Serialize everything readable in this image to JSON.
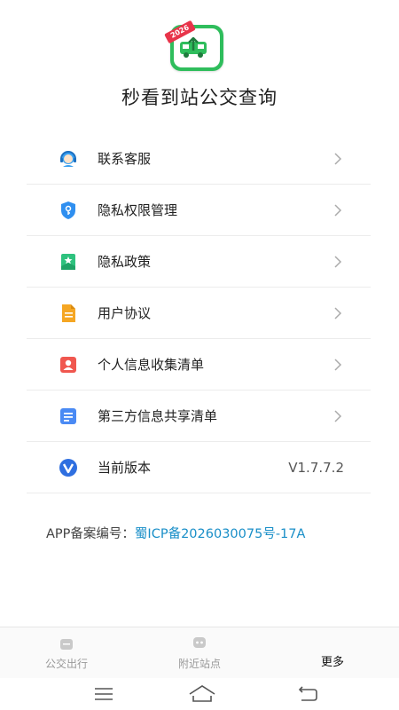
{
  "app": {
    "title": "秒看到站公交查询",
    "logo_badge": "2026",
    "logo_icon": "bus-upload-icon",
    "brand_color": "#2fbd5c"
  },
  "menu": {
    "items": [
      {
        "label": "联系客服",
        "icon": "customer-service-icon",
        "has_chevron": true
      },
      {
        "label": "隐私权限管理",
        "icon": "privacy-shield-icon",
        "has_chevron": true
      },
      {
        "label": "隐私政策",
        "icon": "bookmark-star-icon",
        "has_chevron": true
      },
      {
        "label": "用户协议",
        "icon": "document-icon",
        "has_chevron": true
      },
      {
        "label": "个人信息收集清单",
        "icon": "person-card-icon",
        "has_chevron": true
      },
      {
        "label": "第三方信息共享清单",
        "icon": "list-document-icon",
        "has_chevron": true
      },
      {
        "label": "当前版本",
        "icon": "version-v-icon",
        "value": "V1.7.7.2"
      }
    ]
  },
  "record": {
    "prefix": "APP备案编号：",
    "number": "蜀ICP备2026030075号-17A",
    "link_color": "#1a8fc8"
  },
  "tabbar": {
    "tabs": [
      {
        "label": "公交出行",
        "active": false
      },
      {
        "label": "附近站点",
        "active": false
      },
      {
        "label": "更多",
        "active": true
      }
    ]
  },
  "navbar": {
    "buttons": [
      "menu-icon",
      "home-icon",
      "back-icon"
    ]
  }
}
